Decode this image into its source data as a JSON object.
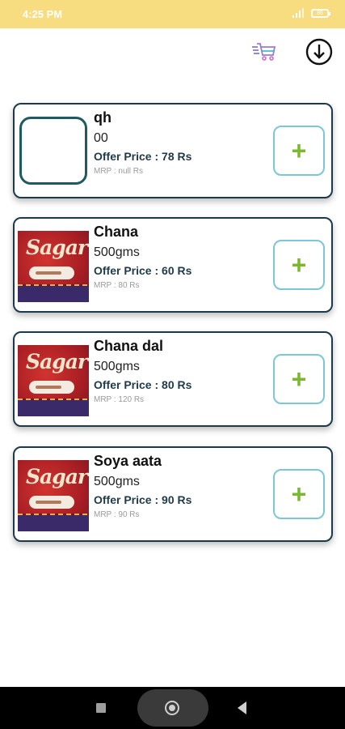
{
  "status_bar": {
    "time": "4:25 PM",
    "battery": "86"
  },
  "toolbar": {
    "cart_icon": "cart-fast-icon",
    "download_icon": "download-circle-icon"
  },
  "products": [
    {
      "name": "qh",
      "quantity": "00",
      "offer_price": "Offer Price : 78 Rs",
      "mrp": "MRP : null Rs",
      "image": "empty"
    },
    {
      "name": "Chana",
      "quantity": "500gms",
      "offer_price": "Offer Price : 60 Rs",
      "mrp": "MRP : 80 Rs",
      "image": "sagar-pack"
    },
    {
      "name": "Chana dal",
      "quantity": "500gms",
      "offer_price": "Offer Price : 80 Rs",
      "mrp": "MRP : 120 Rs",
      "image": "sagar-pack"
    },
    {
      "name": "Soya aata",
      "quantity": "500gms",
      "offer_price": "Offer Price : 90 Rs",
      "mrp": "MRP : 90 Rs",
      "image": "sagar-pack"
    }
  ],
  "add_button_symbol": "+",
  "pack_logo_text": "Sagar",
  "colors": {
    "status_bar": "#f7dc80",
    "card_border": "#1b3a4b",
    "add_border": "#7cc7d6",
    "add_plus": "#7cb82f"
  }
}
